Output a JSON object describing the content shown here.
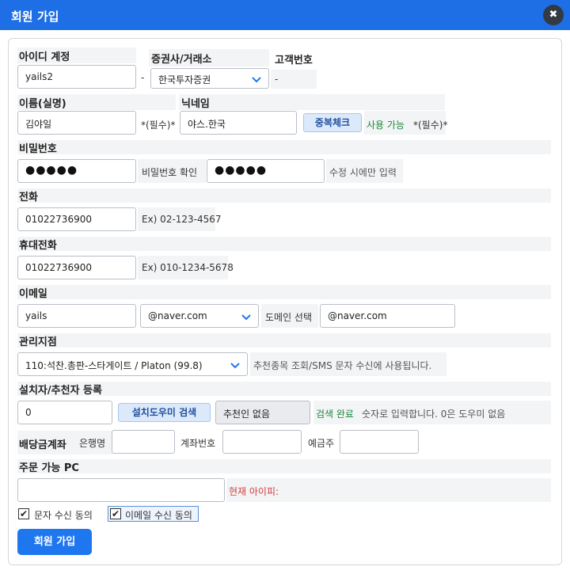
{
  "window": {
    "title": "회원 가입",
    "close_glyph": "✖"
  },
  "account": {
    "userid_label": "아이디 계정",
    "userid_value": "yails2",
    "dash": "-",
    "broker_label": "증권사/거래소",
    "broker_value": "한국투자증권",
    "customer_no_label": "고객번호",
    "customer_no_value": "-"
  },
  "name": {
    "label": "이름(실명)",
    "value": "김야일",
    "required": "*(필수)*",
    "nickname_label": "닉네임",
    "nickname_value": "야스.한국",
    "dup_check_button": "중복체크",
    "available_text": "사용 가능",
    "nick_required": "*(필수)*"
  },
  "password": {
    "label": "비밀번호",
    "value": "●●●●●",
    "confirm_label": "비밀번호 확인",
    "confirm_value": "●●●●●",
    "hint": "수정 시에만 입력"
  },
  "phone": {
    "label": "전화",
    "value": "01022736900",
    "example": "Ex) 02-123-4567"
  },
  "mobile": {
    "label": "휴대전화",
    "value": "01022736900",
    "example": "Ex) 010-1234-5678"
  },
  "email": {
    "label": "이메일",
    "id_value": "yails",
    "domain_select": "@naver.com",
    "domain_select_label": "도메인 선택",
    "domain_value": "@naver.com"
  },
  "branch": {
    "label": "관리지점",
    "value": "110:석찬.총판-스타게이트 / Platon (99.8)",
    "note": "추천종목 조회/SMS 문자 수신에 사용됩니다."
  },
  "installer": {
    "label": "설치자/추천자 등록",
    "value": "0",
    "search_button": "설치도우미 검색",
    "recommender_value": "추천인 없음",
    "search_done": "검색 완료",
    "note": "숫자로 입력합니다. 0은 도우미 없음"
  },
  "bank": {
    "label": "배당금계좌",
    "bank_name_label": "은행명",
    "account_no_label": "계좌번호",
    "holder_label": "예금주",
    "bank_name_value": "",
    "account_no_value": "",
    "holder_value": ""
  },
  "pc": {
    "label": "주문 가능 PC",
    "value": "",
    "current_ip_label": "현재 아이피:"
  },
  "consent": {
    "sms_label": "문자 수신 동의",
    "email_label": "이메일 수신 동의",
    "check_glyph": "✔"
  },
  "submit_button": "회원 가입",
  "colors": {
    "titlebar": "#1e6fe6",
    "primary": "#1f77f0",
    "success": "#1b8a3a",
    "warning": "#d43b3b"
  },
  "icons": {
    "close": "close-icon",
    "chevron": "chevron-down-icon",
    "checkbox": "checkbox-icon"
  }
}
